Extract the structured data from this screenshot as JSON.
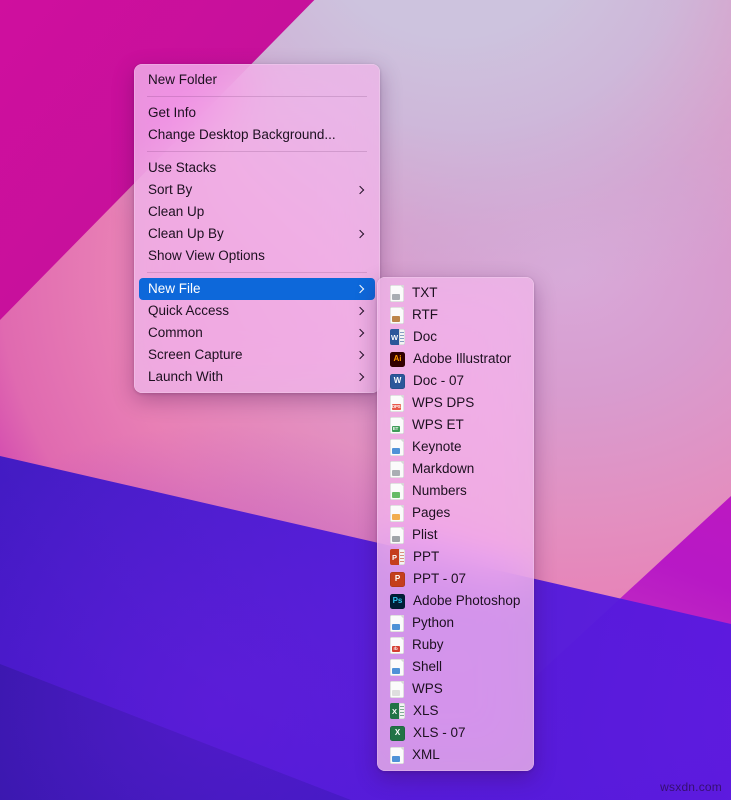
{
  "desktop": {
    "watermark": "wsxdn.com",
    "wallpaper_colors": {
      "magenta": "#c4109a",
      "purple": "#8b12d4",
      "indigo": "#4b1bd8",
      "pink_bloom": "#e38fc0",
      "lavender": "#cdc3de"
    }
  },
  "context_menu": {
    "accent_color": "#0d68da",
    "groups": [
      {
        "items": [
          {
            "label": "New Folder",
            "submenu": false,
            "selected": false
          }
        ]
      },
      {
        "items": [
          {
            "label": "Get Info",
            "submenu": false,
            "selected": false
          },
          {
            "label": "Change Desktop Background...",
            "submenu": false,
            "selected": false
          }
        ]
      },
      {
        "items": [
          {
            "label": "Use Stacks",
            "submenu": false,
            "selected": false
          },
          {
            "label": "Sort By",
            "submenu": true,
            "selected": false
          },
          {
            "label": "Clean Up",
            "submenu": false,
            "selected": false
          },
          {
            "label": "Clean Up By",
            "submenu": true,
            "selected": false
          },
          {
            "label": "Show View Options",
            "submenu": false,
            "selected": false
          }
        ]
      },
      {
        "items": [
          {
            "label": "New File",
            "submenu": true,
            "selected": true
          },
          {
            "label": "Quick Access",
            "submenu": true,
            "selected": false
          },
          {
            "label": "Common",
            "submenu": true,
            "selected": false
          },
          {
            "label": "Screen Capture",
            "submenu": true,
            "selected": false
          },
          {
            "label": "Launch With",
            "submenu": true,
            "selected": false
          }
        ]
      }
    ]
  },
  "new_file_submenu": {
    "parent": "New File",
    "items": [
      {
        "label": "TXT",
        "icon": "txt-file-icon",
        "style": "page",
        "tag": "",
        "tag_color": "#9aa0a6",
        "block_color": ""
      },
      {
        "label": "RTF",
        "icon": "rtf-file-icon",
        "style": "page",
        "tag": "",
        "tag_color": "#b0702a",
        "block_color": ""
      },
      {
        "label": "Doc",
        "icon": "word-doc-file-icon",
        "style": "office",
        "tag": "W",
        "tag_color": "#ffffff",
        "block_color": "#2b579a"
      },
      {
        "label": "Adobe Illustrator",
        "icon": "adobe-illustrator-file-icon",
        "style": "app",
        "tag": "Ai",
        "tag_color": "#ff9a00",
        "block_color": "#330000"
      },
      {
        "label": "Doc - 07",
        "icon": "word-docx-file-icon",
        "style": "app",
        "tag": "W",
        "tag_color": "#ffffff",
        "block_color": "#2b579a"
      },
      {
        "label": "WPS DPS",
        "icon": "wps-dps-file-icon",
        "style": "page",
        "tag": "DPS",
        "tag_color": "#e8594a",
        "block_color": ""
      },
      {
        "label": "WPS ET",
        "icon": "wps-et-file-icon",
        "style": "page",
        "tag": "ET",
        "tag_color": "#3f9d58",
        "block_color": ""
      },
      {
        "label": "Keynote",
        "icon": "keynote-file-icon",
        "style": "page",
        "tag": "",
        "tag_color": "#2f7fd0",
        "block_color": ""
      },
      {
        "label": "Markdown",
        "icon": "markdown-file-icon",
        "style": "page",
        "tag": "",
        "tag_color": "#9aa0a6",
        "block_color": ""
      },
      {
        "label": "Numbers",
        "icon": "numbers-file-icon",
        "style": "page",
        "tag": "",
        "tag_color": "#49b04a",
        "block_color": ""
      },
      {
        "label": "Pages",
        "icon": "pages-file-icon",
        "style": "page",
        "tag": "",
        "tag_color": "#f0a030",
        "block_color": ""
      },
      {
        "label": "Plist",
        "icon": "plist-file-icon",
        "style": "page",
        "tag": "",
        "tag_color": "#8e9499",
        "block_color": ""
      },
      {
        "label": "PPT",
        "icon": "powerpoint-ppt-file-icon",
        "style": "office",
        "tag": "P",
        "tag_color": "#ffffff",
        "block_color": "#c43e1c"
      },
      {
        "label": "PPT - 07",
        "icon": "powerpoint-pptx-file-icon",
        "style": "app",
        "tag": "P",
        "tag_color": "#ffffff",
        "block_color": "#c43e1c"
      },
      {
        "label": "Adobe Photoshop",
        "icon": "adobe-photoshop-file-icon",
        "style": "app",
        "tag": "Ps",
        "tag_color": "#31c5f0",
        "block_color": "#001e36"
      },
      {
        "label": "Python",
        "icon": "python-file-icon",
        "style": "page",
        "tag": "",
        "tag_color": "#2f7fd0",
        "block_color": ""
      },
      {
        "label": "Ruby",
        "icon": "ruby-file-icon",
        "style": "page",
        "tag": "rb",
        "tag_color": "#d43f32",
        "block_color": ""
      },
      {
        "label": "Shell",
        "icon": "shell-script-file-icon",
        "style": "page",
        "tag": "",
        "tag_color": "#2f7fd0",
        "block_color": ""
      },
      {
        "label": "WPS",
        "icon": "wps-file-icon",
        "style": "page",
        "tag": "",
        "tag_color": "#d8d8d8",
        "block_color": ""
      },
      {
        "label": "XLS",
        "icon": "excel-xls-file-icon",
        "style": "office",
        "tag": "X",
        "tag_color": "#ffffff",
        "block_color": "#217346"
      },
      {
        "label": "XLS - 07",
        "icon": "excel-xlsx-file-icon",
        "style": "app",
        "tag": "X",
        "tag_color": "#ffffff",
        "block_color": "#217346"
      },
      {
        "label": "XML",
        "icon": "xml-file-icon",
        "style": "page",
        "tag": "",
        "tag_color": "#2f7fd0",
        "block_color": ""
      }
    ]
  }
}
